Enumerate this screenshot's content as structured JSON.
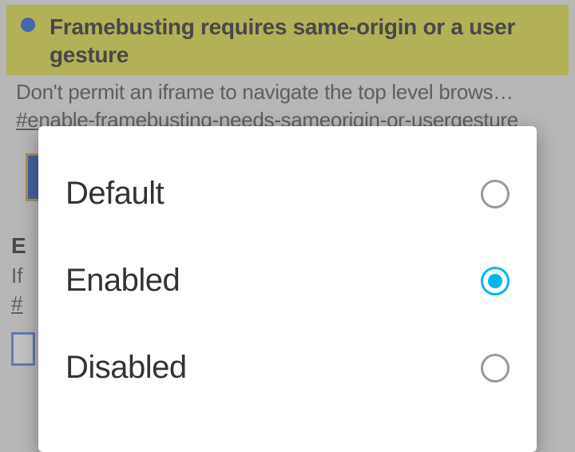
{
  "flag1": {
    "title": "Framebusting requires same-origin or a user gesture",
    "description": "Don't permit an iframe to navigate the top level brows…",
    "anchor": "#enable-framebusting-needs-sameorigin-or-usergesture"
  },
  "flag2": {
    "title_visible": "E",
    "description_visible": "If",
    "anchor_visible": "#"
  },
  "dialog": {
    "options": [
      {
        "label": "Default",
        "selected": false
      },
      {
        "label": "Enabled",
        "selected": true
      },
      {
        "label": "Disabled",
        "selected": false
      }
    ]
  },
  "colors": {
    "highlight": "#e3e03c",
    "bullet": "#1a59d6",
    "radio_selected": "#00b7ee"
  }
}
